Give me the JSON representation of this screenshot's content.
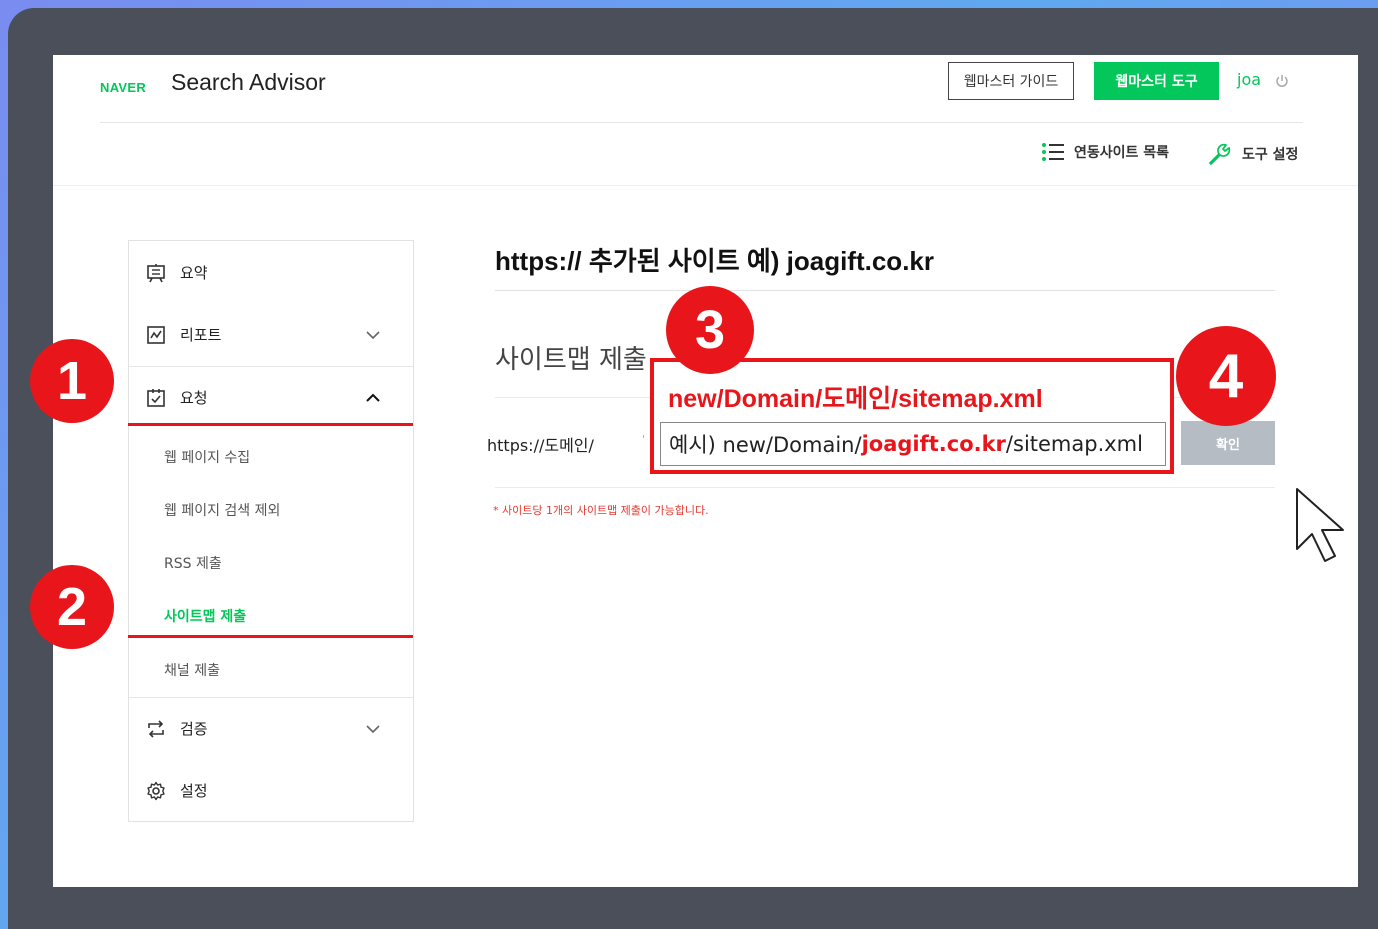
{
  "header": {
    "logo": "NAVER",
    "brand": "Search Advisor",
    "guide_button": "웹마스터 가이드",
    "tool_button": "웹마스터 도구",
    "user": "joa"
  },
  "subnav": {
    "sites_label": "연동사이트 목록",
    "settings_label": "도구 설정"
  },
  "sidebar": {
    "summary": "요약",
    "report": "리포트",
    "request": "요청",
    "request_items": [
      "웹 페이지 수집",
      "웹 페이지 검색 제외",
      "RSS 제출",
      "사이트맵 제출",
      "채널 제출"
    ],
    "verify": "검증",
    "settings": "설정"
  },
  "main": {
    "site_title": "https:// 추가된 사이트 예) joagift.co.kr",
    "section_title": "사이트맵 제출",
    "url_prefix": "https://도메인/",
    "tick": "'",
    "confirm_button": "확인",
    "note": "* 사이트당 1개의 사이트맵 제출이 가능합니다."
  },
  "annotation": {
    "path_hint": "new/Domain/도메인/sitemap.xml",
    "example_prefix": "예시) new/Domain/",
    "example_domain": "joagift.co.kr",
    "example_suffix": "/sitemap.xml",
    "badges": [
      "1",
      "2",
      "3",
      "4"
    ]
  },
  "colors": {
    "naver_green": "#03c75a",
    "annotation_red": "#e8161b",
    "frame": "#4a4f5a"
  }
}
